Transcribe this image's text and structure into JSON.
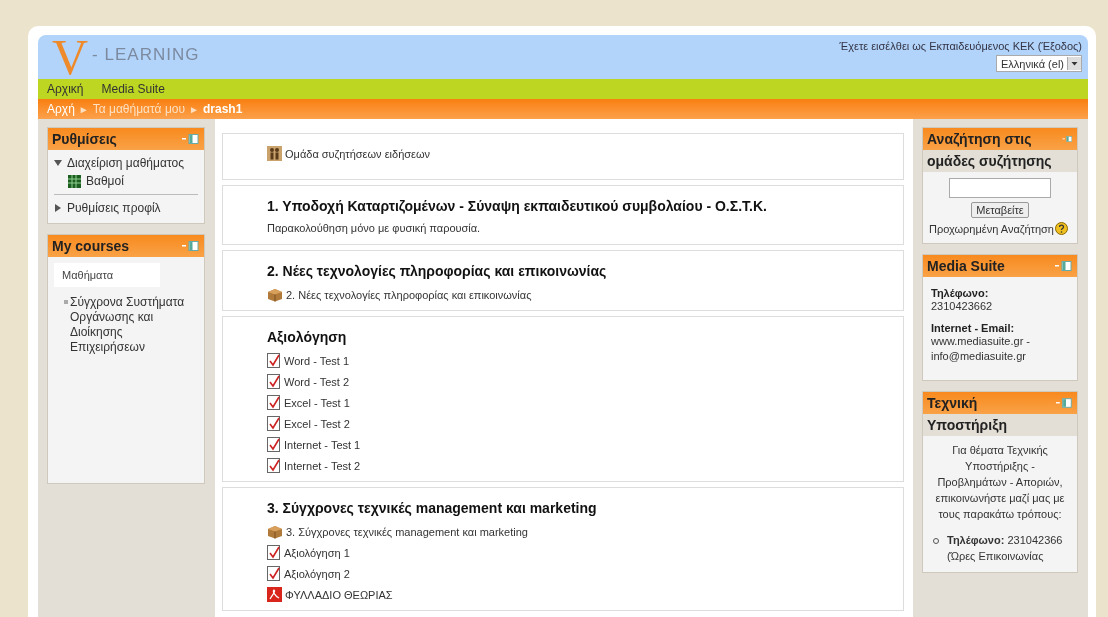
{
  "header": {
    "logo_letter": "V",
    "logo_text": "- LEARNING",
    "login_info": "Έχετε εισέλθει ως Εκπαιδευόμενος ΚΕΚ (Έξοδος)",
    "language": "Ελληνικά (el)"
  },
  "nav": [
    "Αρχική",
    "Media Suite"
  ],
  "breadcrumb": [
    {
      "kind": "link",
      "label": "Αρχή"
    },
    {
      "kind": "separator",
      "label": "►"
    },
    {
      "kind": "muted",
      "label": "Τα μαθήματά μου"
    },
    {
      "kind": "separator",
      "label": "►"
    },
    {
      "kind": "current",
      "label": "drash1"
    }
  ],
  "left_blocks": [
    {
      "kind": "tree",
      "title": "Ρυθμίσεις",
      "items": [
        {
          "label": "Διαχείριση μαθήματος",
          "expanded": true,
          "children": [
            {
              "label": "Βαθμοί"
            }
          ]
        },
        {
          "label": "Ρυθμίσεις προφίλ",
          "expanded": false
        }
      ]
    },
    {
      "kind": "courses",
      "title": "My courses",
      "tab": "Μαθήματα",
      "items": [
        "Σύγχρονα Συστήματα Οργάνωσης και Διοίκησης Επιχειρήσεων"
      ]
    }
  ],
  "sections": [
    {
      "items": [
        {
          "kind": "forum",
          "label": "Ομάδα συζητήσεων ειδήσεων"
        }
      ]
    },
    {
      "title": "1. Υποδοχή Καταρτιζομένων - Σύναψη εκπαιδευτικού συμβολαίου - Ο.Σ.Τ.Κ.",
      "summary": "Παρακολούθηση μόνο με φυσική παρουσία."
    },
    {
      "title": "2. Νέες τεχνολογίες πληροφορίας και επικοινωνίας",
      "items": [
        {
          "kind": "package",
          "label": "2. Νέες τεχνολογίες πληροφορίας και επικοινωνίας"
        }
      ]
    },
    {
      "title": "Αξιολόγηση",
      "items": [
        {
          "kind": "quiz",
          "label": "Word - Test 1"
        },
        {
          "kind": "quiz",
          "label": "Word - Test 2"
        },
        {
          "kind": "quiz",
          "label": "Excel - Test 1"
        },
        {
          "kind": "quiz",
          "label": "Excel - Test 2"
        },
        {
          "kind": "quiz",
          "label": "Internet - Test 1"
        },
        {
          "kind": "quiz",
          "label": "Internet - Test 2"
        }
      ]
    },
    {
      "title": "3. Σύγχρονες τεχνικές management και marketing",
      "items": [
        {
          "kind": "package",
          "label": "3. Σύγχρονες τεχνικές management και marketing"
        },
        {
          "kind": "quiz",
          "label": "Αξιολόγηση 1"
        },
        {
          "kind": "quiz",
          "label": "Αξιολόγηση 2"
        },
        {
          "kind": "pdf",
          "label": "ΦΥΛΛΑΔΙΟ ΘΕΩΡΙΑΣ"
        }
      ]
    }
  ],
  "right_blocks": [
    {
      "kind": "search",
      "title": "Αναζήτηση στις ομάδες συζήτησης",
      "button": "Μεταβείτε",
      "link": "Προχωρημένη Αναζήτηση"
    },
    {
      "kind": "contact",
      "title": "Media Suite",
      "entries": [
        {
          "label": "Τηλέφωνο:",
          "value": "2310423662"
        },
        {
          "label": "Internet - Email:",
          "value": "www.mediasuite.gr - info@mediasuite.gr"
        }
      ]
    },
    {
      "kind": "support",
      "title": "Τεχνική Υποστήριξη",
      "text": "Για θέματα Τεχνικής Υποστήριξης - Προβλημάτων - Αποριών, επικοινωνήστε μαζί μας με τους παρακάτω τρόπους:",
      "list": [
        "**Τηλέφωνο:** 231042366 (Ώρες Επικοινωνίας"
      ]
    }
  ]
}
